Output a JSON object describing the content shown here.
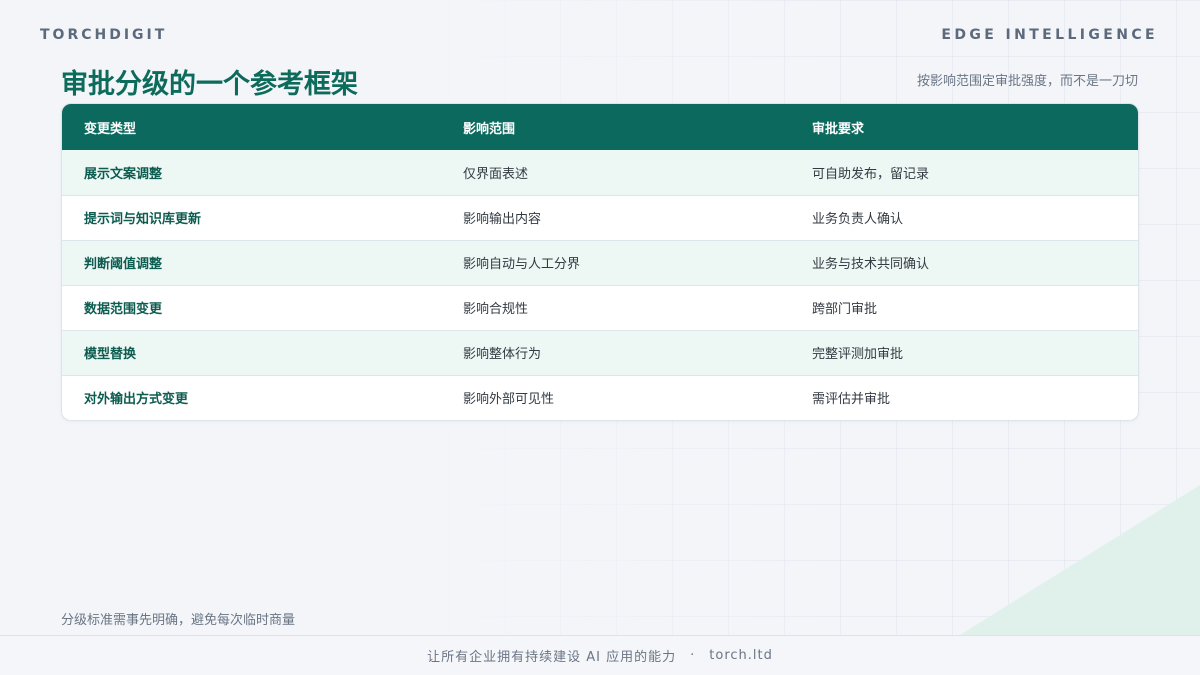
{
  "header": {
    "brand_left": "TORCHDIGIT",
    "brand_right": "EDGE INTELLIGENCE"
  },
  "title": "审批分级的一个参考框架",
  "subtitle": "按影响范围定审批强度，而不是一刀切",
  "table": {
    "columns": [
      "变更类型",
      "影响范围",
      "审批要求"
    ],
    "rows": [
      [
        "展示文案调整",
        "仅界面表述",
        "可自助发布，留记录"
      ],
      [
        "提示词与知识库更新",
        "影响输出内容",
        "业务负责人确认"
      ],
      [
        "判断阈值调整",
        "影响自动与人工分界",
        "业务与技术共同确认"
      ],
      [
        "数据范围变更",
        "影响合规性",
        "跨部门审批"
      ],
      [
        "模型替换",
        "影响整体行为",
        "完整评测加审批"
      ],
      [
        "对外输出方式变更",
        "影响外部可见性",
        "需评估并审批"
      ]
    ]
  },
  "footnote": "分级标准需事先明确，避免每次临时商量",
  "footer": {
    "tagline": "让所有企业拥有持续建设 AI 应用的能力",
    "separator": "·",
    "site": "torch.ltd"
  },
  "colors": {
    "accent": "#0b6a5d",
    "title": "#0d6b5b",
    "row_alt": "#edf7f4"
  }
}
